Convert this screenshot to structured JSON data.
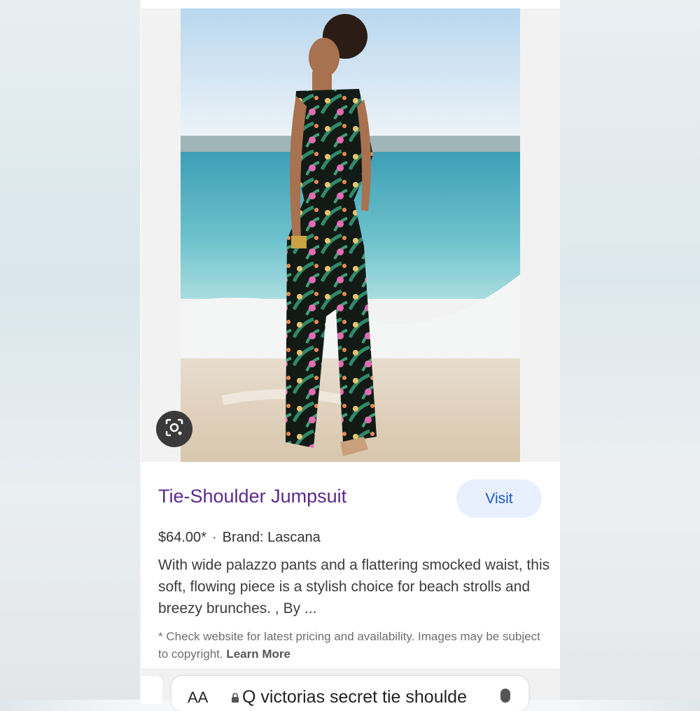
{
  "product": {
    "title": "Tie-Shoulder Jumpsuit",
    "visit_label": "Visit",
    "price": "$64.00*",
    "separator": "·",
    "brand": "Brand: Lascana",
    "description": "With wide palazzo pants and a flattering smocked waist, this soft, flowing piece is a stylish choice for beach strolls and breezy brunches. , By ...",
    "disclaimer": "* Check website for latest pricing and availability. Images may be subject to copyright.",
    "learn_more": "Learn More"
  },
  "browser": {
    "text_size_label": "AA",
    "address_text": "Q victorias secret tie shoulde"
  },
  "colors": {
    "title": "#5b2a8c",
    "visit_bg": "#e8f0fe",
    "visit_text": "#1a56c4"
  },
  "icons": {
    "lens": "lens-icon",
    "lock": "lock-icon",
    "mic": "mic-icon"
  }
}
